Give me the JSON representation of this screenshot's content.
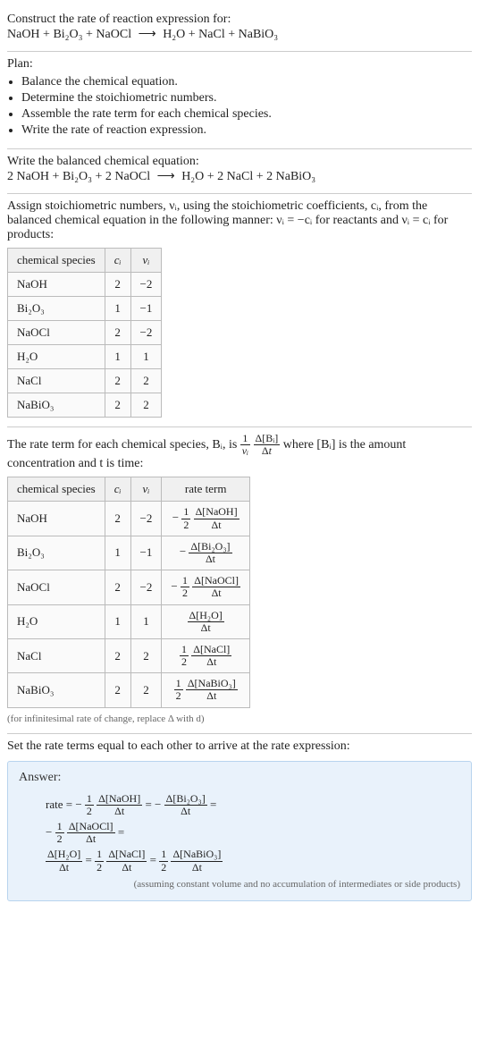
{
  "prompt": {
    "line1": "Construct the rate of reaction expression for:",
    "equation_lhs": "NaOH + Bi₂O₃ + NaOCl",
    "arrow": "⟶",
    "equation_rhs": "H₂O + NaCl + NaBiO₃"
  },
  "plan": {
    "heading": "Plan:",
    "items": [
      "Balance the chemical equation.",
      "Determine the stoichiometric numbers.",
      "Assemble the rate term for each chemical species.",
      "Write the rate of reaction expression."
    ]
  },
  "balanced": {
    "heading": "Write the balanced chemical equation:",
    "lhs": "2 NaOH + Bi₂O₃ + 2 NaOCl",
    "arrow": "⟶",
    "rhs": "H₂O + 2 NaCl + 2 NaBiO₃"
  },
  "stoich": {
    "heading_1": "Assign stoichiometric numbers, νᵢ, using the stoichiometric coefficients, cᵢ, from the balanced chemical equation in the following manner: νᵢ = −cᵢ for reactants and νᵢ = cᵢ for products:",
    "cols": [
      "chemical species",
      "cᵢ",
      "νᵢ"
    ],
    "rows": [
      {
        "species": "NaOH",
        "c": "2",
        "v": "−2"
      },
      {
        "species": "Bi₂O₃",
        "c": "1",
        "v": "−1"
      },
      {
        "species": "NaOCl",
        "c": "2",
        "v": "−2"
      },
      {
        "species": "H₂O",
        "c": "1",
        "v": "1"
      },
      {
        "species": "NaCl",
        "c": "2",
        "v": "2"
      },
      {
        "species": "NaBiO₃",
        "c": "2",
        "v": "2"
      }
    ]
  },
  "rate_terms": {
    "intro_a": "The rate term for each chemical species, Bᵢ, is ",
    "intro_b": " where [Bᵢ] is the amount concentration and t is time:",
    "cols": [
      "chemical species",
      "cᵢ",
      "νᵢ",
      "rate term"
    ],
    "rows": [
      {
        "species": "NaOH",
        "c": "2",
        "v": "−2",
        "sign": "−",
        "coef_num": "1",
        "coef_den": "2",
        "dnum": "Δ[NaOH]",
        "dden": "Δt"
      },
      {
        "species": "Bi₂O₃",
        "c": "1",
        "v": "−1",
        "sign": "−",
        "coef_num": "",
        "coef_den": "",
        "dnum": "Δ[Bi₂O₃]",
        "dden": "Δt"
      },
      {
        "species": "NaOCl",
        "c": "2",
        "v": "−2",
        "sign": "−",
        "coef_num": "1",
        "coef_den": "2",
        "dnum": "Δ[NaOCl]",
        "dden": "Δt"
      },
      {
        "species": "H₂O",
        "c": "1",
        "v": "1",
        "sign": "",
        "coef_num": "",
        "coef_den": "",
        "dnum": "Δ[H₂O]",
        "dden": "Δt"
      },
      {
        "species": "NaCl",
        "c": "2",
        "v": "2",
        "sign": "",
        "coef_num": "1",
        "coef_den": "2",
        "dnum": "Δ[NaCl]",
        "dden": "Δt"
      },
      {
        "species": "NaBiO₃",
        "c": "2",
        "v": "2",
        "sign": "",
        "coef_num": "1",
        "coef_den": "2",
        "dnum": "Δ[NaBiO₃]",
        "dden": "Δt"
      }
    ],
    "note": "(for infinitesimal rate of change, replace Δ with d)"
  },
  "final": {
    "heading": "Set the rate terms equal to each other to arrive at the rate expression:",
    "answer_label": "Answer:",
    "rate_label": "rate = ",
    "eq_sign": " = ",
    "terms": [
      {
        "sign": "−",
        "coef_num": "1",
        "coef_den": "2",
        "dnum": "Δ[NaOH]",
        "dden": "Δt"
      },
      {
        "sign": "−",
        "coef_num": "",
        "coef_den": "",
        "dnum": "Δ[Bi₂O₃]",
        "dden": "Δt"
      },
      {
        "sign": "−",
        "coef_num": "1",
        "coef_den": "2",
        "dnum": "Δ[NaOCl]",
        "dden": "Δt"
      },
      {
        "sign": "",
        "coef_num": "",
        "coef_den": "",
        "dnum": "Δ[H₂O]",
        "dden": "Δt"
      },
      {
        "sign": "",
        "coef_num": "1",
        "coef_den": "2",
        "dnum": "Δ[NaCl]",
        "dden": "Δt"
      },
      {
        "sign": "",
        "coef_num": "1",
        "coef_den": "2",
        "dnum": "Δ[NaBiO₃]",
        "dden": "Δt"
      }
    ],
    "note": "(assuming constant volume and no accumulation of intermediates or side products)"
  }
}
